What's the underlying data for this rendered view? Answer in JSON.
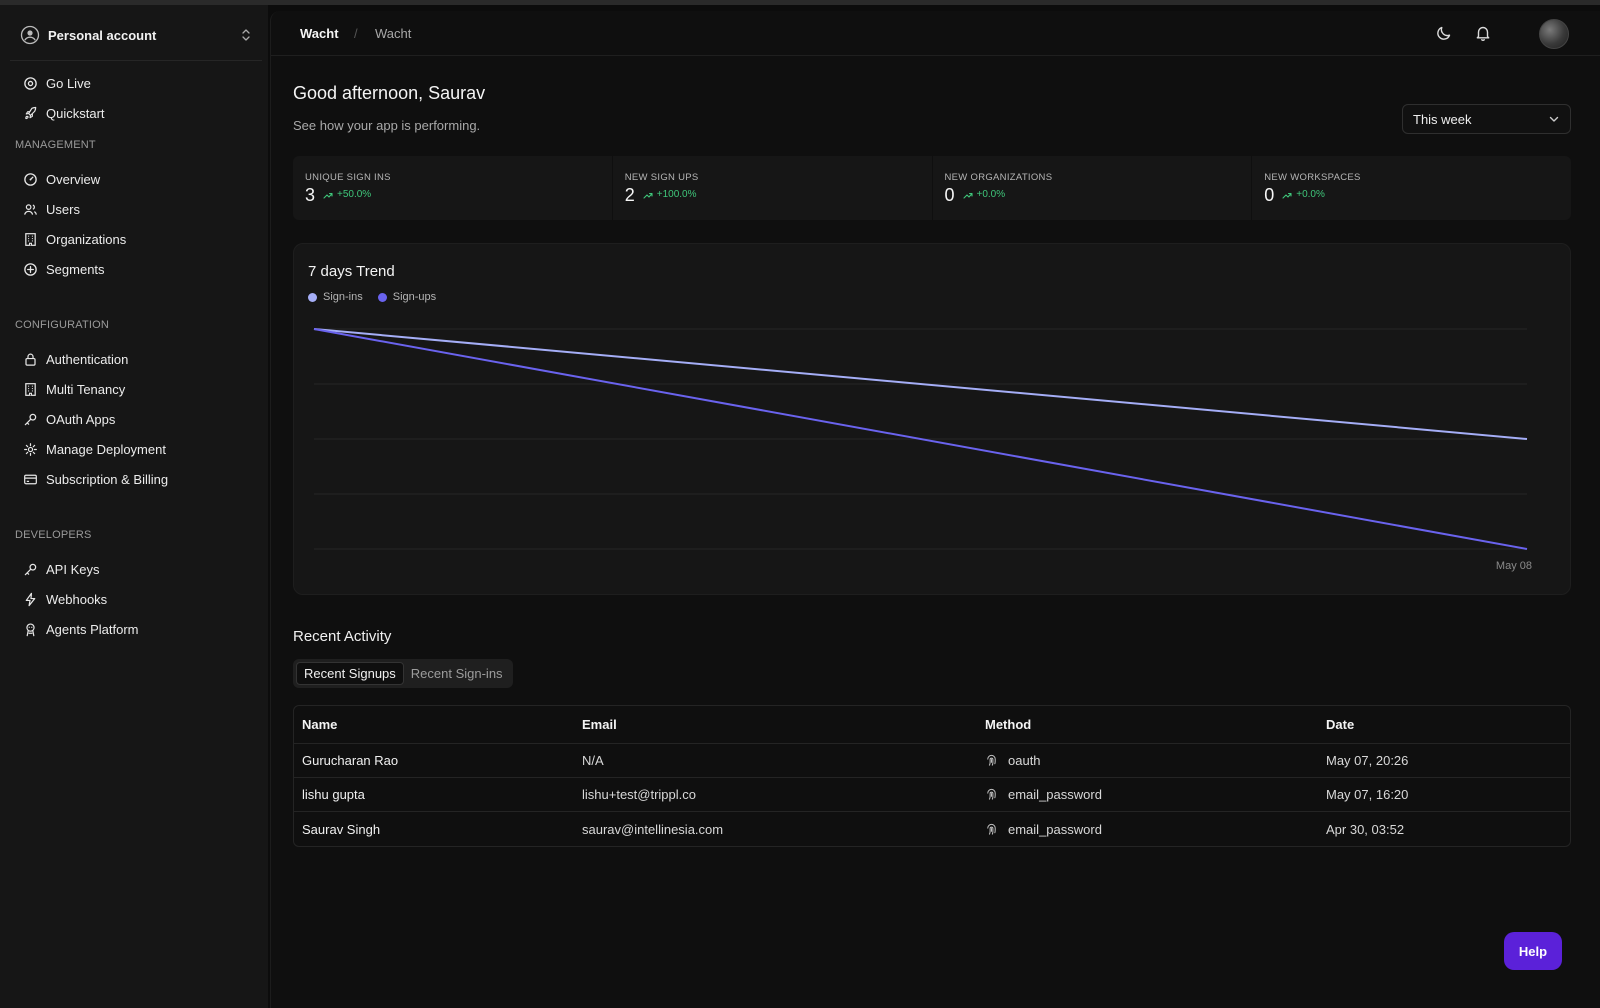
{
  "sidebar": {
    "account_label": "Personal account",
    "top_items": [
      {
        "label": "Go Live",
        "icon": "radio-icon"
      },
      {
        "label": "Quickstart",
        "icon": "rocket-icon"
      }
    ],
    "sections": [
      {
        "title": "MANAGEMENT",
        "items": [
          {
            "label": "Overview",
            "icon": "gauge-icon"
          },
          {
            "label": "Users",
            "icon": "users-icon"
          },
          {
            "label": "Organizations",
            "icon": "building-icon"
          },
          {
            "label": "Segments",
            "icon": "segments-icon"
          }
        ]
      },
      {
        "title": "CONFIGURATION",
        "items": [
          {
            "label": "Authentication",
            "icon": "lock-icon"
          },
          {
            "label": "Multi Tenancy",
            "icon": "building-icon"
          },
          {
            "label": "OAuth Apps",
            "icon": "key-icon"
          },
          {
            "label": "Manage Deployment",
            "icon": "gear-icon"
          },
          {
            "label": "Subscription & Billing",
            "icon": "credit-card-icon"
          }
        ]
      },
      {
        "title": "DEVELOPERS",
        "items": [
          {
            "label": "API Keys",
            "icon": "key-icon"
          },
          {
            "label": "Webhooks",
            "icon": "bolt-icon"
          },
          {
            "label": "Agents Platform",
            "icon": "agent-icon"
          }
        ]
      }
    ]
  },
  "header": {
    "breadcrumb": [
      "Wacht",
      "Wacht"
    ],
    "separator": "/"
  },
  "dashboard": {
    "greeting": "Good afternoon, Saurav",
    "subtitle": "See how your app is performing.",
    "period": "This week",
    "stats": [
      {
        "label": "UNIQUE SIGN INS",
        "value": "3",
        "delta": "+50.0%"
      },
      {
        "label": "NEW SIGN UPS",
        "value": "2",
        "delta": "+100.0%"
      },
      {
        "label": "NEW ORGANIZATIONS",
        "value": "0",
        "delta": "+0.0%"
      },
      {
        "label": "NEW WORKSPACES",
        "value": "0",
        "delta": "+0.0%"
      }
    ]
  },
  "chart_data": {
    "type": "line",
    "title": "7 days Trend",
    "x": [
      "",
      "May 08"
    ],
    "series": [
      {
        "name": "Sign-ins",
        "color": "#a5aef7",
        "values": [
          4,
          2
        ]
      },
      {
        "name": "Sign-ups",
        "color": "#6a63ee",
        "values": [
          4,
          0
        ]
      }
    ],
    "ylim": [
      0,
      4
    ],
    "grid": true,
    "legend": "top-left"
  },
  "recent": {
    "title": "Recent Activity",
    "tabs": [
      "Recent Signups",
      "Recent Sign-ins"
    ],
    "columns": [
      "Name",
      "Email",
      "Method",
      "Date"
    ],
    "rows": [
      {
        "name": "Gurucharan Rao",
        "email": "N/A",
        "method": "oauth",
        "date": "May 07, 20:26"
      },
      {
        "name": "lishu gupta",
        "email": "lishu+test@trippl.co",
        "method": "email_password",
        "date": "May 07, 16:20"
      },
      {
        "name": "Saurav Singh",
        "email": "saurav@intellinesia.com",
        "method": "email_password",
        "date": "Apr 30, 03:52"
      }
    ]
  },
  "help_label": "Help",
  "colors": {
    "accent": "#5b21d9",
    "positive": "#3fc67a"
  }
}
